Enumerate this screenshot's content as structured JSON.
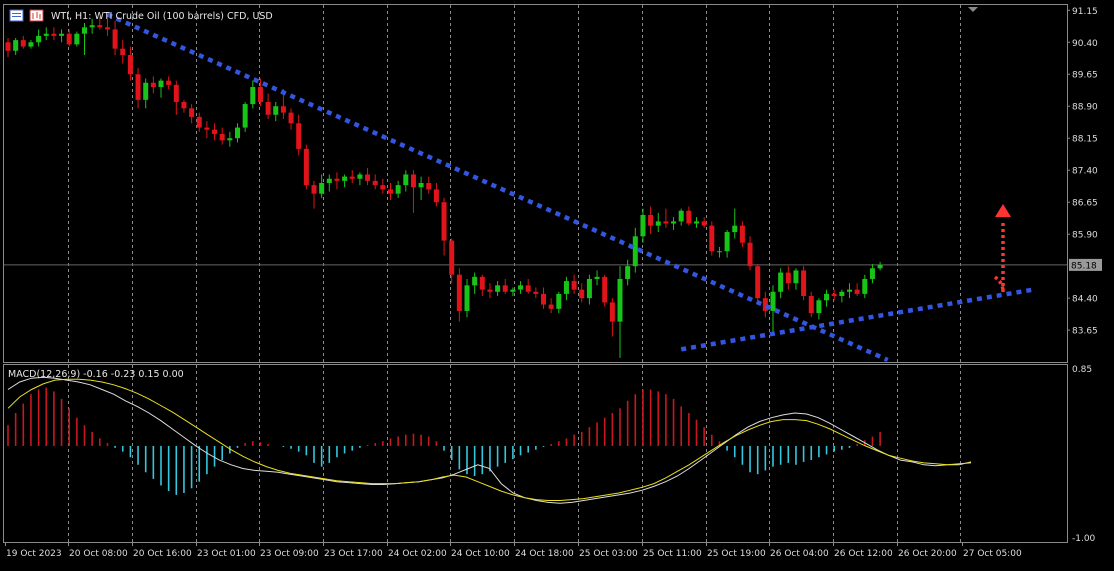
{
  "header": {
    "symbol_title": "WTI, H1:  WTI Crude Oil (100 barrels) CFD, USD",
    "macd_title": "MACD(12,26,9) -0.16 -0.23 0.15 0.00"
  },
  "colors": {
    "background": "#000000",
    "grid": "#8a8a8a",
    "bull": "#19c419",
    "bear": "#e0141a",
    "wick": "#e6e6e6",
    "trendline": "#3355e0",
    "arrow": "#ff3333",
    "macd_pos": "#c8181e",
    "macd_neg": "#36c6dd",
    "signal": "#e8e020",
    "macd_line": "#dddddd"
  },
  "chart_data": [
    {
      "type": "candlestick",
      "name": "price",
      "price_axis_ticks": [
        "91.15",
        "90.40",
        "89.65",
        "88.90",
        "88.15",
        "87.40",
        "86.65",
        "85.90",
        "85.18",
        "84.40",
        "83.65"
      ],
      "current_price": "85.18",
      "ylim": [
        82.95,
        91.25
      ],
      "time_labels": [
        "19 Oct 2023",
        "20 Oct 08:00",
        "20 Oct 16:00",
        "23 Oct 01:00",
        "23 Oct 09:00",
        "23 Oct 17:00",
        "24 Oct 02:00",
        "24 Oct 10:00",
        "24 Oct 18:00",
        "25 Oct 03:00",
        "25 Oct 11:00",
        "25 Oct 19:00",
        "26 Oct 04:00",
        "26 Oct 12:00",
        "26 Oct 20:00",
        "27 Oct 05:00"
      ],
      "candles": [
        [
          90.4,
          90.5,
          90.05,
          90.2
        ],
        [
          90.2,
          90.5,
          90.1,
          90.45
        ],
        [
          90.45,
          90.55,
          90.25,
          90.3
        ],
        [
          90.3,
          90.45,
          90.25,
          90.4
        ],
        [
          90.4,
          90.7,
          90.3,
          90.55
        ],
        [
          90.55,
          90.75,
          90.45,
          90.6
        ],
        [
          90.6,
          90.75,
          90.45,
          90.55
        ],
        [
          90.55,
          90.7,
          90.4,
          90.6
        ],
        [
          90.6,
          90.7,
          90.3,
          90.35
        ],
        [
          90.35,
          90.65,
          90.3,
          90.6
        ],
        [
          90.6,
          90.85,
          90.1,
          90.75
        ],
        [
          90.75,
          90.95,
          90.6,
          90.8
        ],
        [
          90.8,
          91.0,
          90.7,
          90.75
        ],
        [
          90.75,
          90.95,
          90.55,
          90.7
        ],
        [
          90.7,
          90.9,
          90.1,
          90.25
        ],
        [
          90.25,
          90.45,
          89.9,
          90.1
        ],
        [
          90.1,
          90.3,
          89.5,
          89.65
        ],
        [
          89.65,
          89.8,
          88.85,
          89.05
        ],
        [
          89.05,
          89.55,
          88.85,
          89.45
        ],
        [
          89.45,
          89.6,
          89.2,
          89.35
        ],
        [
          89.35,
          89.55,
          89.1,
          89.5
        ],
        [
          89.5,
          89.6,
          89.3,
          89.4
        ],
        [
          89.4,
          89.5,
          88.7,
          89.0
        ],
        [
          89.0,
          89.05,
          88.75,
          88.85
        ],
        [
          88.85,
          88.95,
          88.5,
          88.65
        ],
        [
          88.65,
          88.75,
          88.3,
          88.4
        ],
        [
          88.4,
          88.55,
          88.15,
          88.35
        ],
        [
          88.35,
          88.5,
          88.1,
          88.25
        ],
        [
          88.25,
          88.4,
          88.0,
          88.1
        ],
        [
          88.1,
          88.3,
          87.95,
          88.15
        ],
        [
          88.15,
          88.5,
          88.05,
          88.4
        ],
        [
          88.4,
          89.0,
          88.3,
          88.95
        ],
        [
          88.95,
          89.5,
          88.85,
          89.35
        ],
        [
          89.35,
          89.55,
          88.9,
          89.0
        ],
        [
          89.0,
          89.2,
          88.6,
          88.7
        ],
        [
          88.7,
          89.0,
          88.55,
          88.9
        ],
        [
          88.9,
          89.3,
          88.6,
          88.75
        ],
        [
          88.75,
          88.85,
          88.35,
          88.5
        ],
        [
          88.5,
          88.7,
          87.75,
          87.9
        ],
        [
          87.9,
          88.0,
          86.95,
          87.05
        ],
        [
          87.05,
          87.15,
          86.5,
          86.85
        ],
        [
          86.85,
          87.3,
          86.75,
          87.1
        ],
        [
          87.1,
          87.3,
          86.9,
          87.2
        ],
        [
          87.2,
          87.35,
          86.95,
          87.15
        ],
        [
          87.15,
          87.3,
          87.0,
          87.25
        ],
        [
          87.25,
          87.4,
          87.1,
          87.2
        ],
        [
          87.2,
          87.35,
          87.05,
          87.3
        ],
        [
          87.3,
          87.45,
          87.05,
          87.15
        ],
        [
          87.15,
          87.3,
          86.95,
          87.05
        ],
        [
          87.05,
          87.2,
          86.85,
          86.95
        ],
        [
          86.95,
          87.1,
          86.7,
          86.85
        ],
        [
          86.85,
          87.15,
          86.75,
          87.05
        ],
        [
          87.05,
          87.4,
          86.9,
          87.3
        ],
        [
          87.3,
          87.4,
          86.4,
          87.0
        ],
        [
          87.0,
          87.25,
          86.7,
          87.1
        ],
        [
          87.1,
          87.25,
          86.85,
          86.95
        ],
        [
          86.95,
          87.1,
          86.55,
          86.65
        ],
        [
          86.65,
          86.75,
          85.4,
          85.75
        ],
        [
          85.75,
          85.8,
          84.75,
          84.95
        ],
        [
          84.95,
          85.1,
          83.85,
          84.1
        ],
        [
          84.1,
          84.85,
          83.95,
          84.7
        ],
        [
          84.7,
          85.0,
          84.5,
          84.9
        ],
        [
          84.9,
          84.95,
          84.45,
          84.6
        ],
        [
          84.6,
          84.75,
          84.4,
          84.55
        ],
        [
          84.55,
          84.8,
          84.45,
          84.7
        ],
        [
          84.7,
          84.85,
          84.5,
          84.55
        ],
        [
          84.55,
          84.65,
          84.45,
          84.6
        ],
        [
          84.6,
          84.8,
          84.5,
          84.7
        ],
        [
          84.7,
          84.85,
          84.5,
          84.55
        ],
        [
          84.55,
          84.65,
          84.4,
          84.5
        ],
        [
          84.5,
          84.65,
          84.15,
          84.25
        ],
        [
          84.25,
          84.4,
          84.05,
          84.15
        ],
        [
          84.15,
          84.55,
          84.05,
          84.5
        ],
        [
          84.5,
          84.9,
          84.35,
          84.8
        ],
        [
          84.8,
          84.95,
          84.5,
          84.6
        ],
        [
          84.6,
          84.75,
          84.3,
          84.4
        ],
        [
          84.4,
          84.95,
          84.25,
          84.85
        ],
        [
          84.85,
          85.05,
          84.7,
          84.9
        ],
        [
          84.9,
          84.95,
          84.2,
          84.3
        ],
        [
          84.3,
          84.4,
          83.5,
          83.85
        ],
        [
          83.85,
          85.15,
          83.0,
          84.85
        ],
        [
          84.85,
          85.3,
          84.7,
          85.15
        ],
        [
          85.15,
          86.05,
          85.0,
          85.85
        ],
        [
          85.85,
          86.5,
          85.7,
          86.35
        ],
        [
          86.35,
          86.55,
          85.9,
          86.1
        ],
        [
          86.1,
          86.4,
          85.95,
          86.2
        ],
        [
          86.2,
          86.5,
          86.05,
          86.15
        ],
        [
          86.15,
          86.3,
          86.0,
          86.2
        ],
        [
          86.2,
          86.5,
          86.1,
          86.45
        ],
        [
          86.45,
          86.55,
          86.1,
          86.15
        ],
        [
          86.15,
          86.3,
          86.05,
          86.2
        ],
        [
          86.2,
          86.3,
          86.05,
          86.1
        ],
        [
          86.1,
          86.2,
          85.4,
          85.5
        ],
        [
          85.5,
          85.6,
          85.35,
          85.5
        ],
        [
          85.5,
          86.0,
          85.35,
          85.95
        ],
        [
          85.95,
          86.5,
          85.8,
          86.1
        ],
        [
          86.1,
          86.2,
          85.6,
          85.7
        ],
        [
          85.7,
          85.85,
          85.05,
          85.15
        ],
        [
          85.15,
          85.2,
          84.3,
          84.4
        ],
        [
          84.4,
          84.55,
          83.95,
          84.1
        ],
        [
          84.1,
          84.7,
          83.55,
          84.55
        ],
        [
          84.55,
          85.1,
          84.4,
          85.0
        ],
        [
          85.0,
          85.15,
          84.6,
          84.75
        ],
        [
          84.75,
          85.1,
          84.6,
          85.05
        ],
        [
          85.05,
          85.15,
          84.35,
          84.45
        ],
        [
          84.45,
          84.55,
          83.95,
          84.05
        ],
        [
          84.05,
          84.4,
          83.9,
          84.35
        ],
        [
          84.35,
          84.6,
          84.2,
          84.5
        ],
        [
          84.5,
          84.6,
          84.35,
          84.45
        ],
        [
          84.45,
          84.6,
          84.3,
          84.55
        ],
        [
          84.55,
          84.75,
          84.4,
          84.6
        ],
        [
          84.6,
          84.75,
          84.45,
          84.5
        ],
        [
          84.5,
          84.95,
          84.4,
          84.85
        ],
        [
          84.85,
          85.2,
          84.75,
          85.1
        ],
        [
          85.1,
          85.25,
          85.05,
          85.18
        ]
      ],
      "trendlines": [
        {
          "from": [
            13,
            91.05
          ],
          "to": [
            115,
            82.95
          ]
        },
        {
          "from": [
            88,
            83.2
          ],
          "to": [
            134,
            84.6
          ]
        }
      ]
    },
    {
      "type": "macd",
      "name": "MACD(12,26,9)",
      "axis_ticks": [
        "0.85",
        "-1.00"
      ],
      "ylim": [
        -1.0,
        0.85
      ],
      "histogram": [
        0.22,
        0.35,
        0.45,
        0.55,
        0.6,
        0.62,
        0.58,
        0.5,
        0.4,
        0.3,
        0.22,
        0.15,
        0.08,
        0.03,
        -0.02,
        -0.06,
        -0.12,
        -0.2,
        -0.28,
        -0.35,
        -0.42,
        -0.48,
        -0.52,
        -0.5,
        -0.45,
        -0.38,
        -0.3,
        -0.22,
        -0.15,
        -0.08,
        -0.02,
        0.03,
        0.05,
        0.04,
        0.02,
        0.0,
        -0.01,
        -0.03,
        -0.06,
        -0.1,
        -0.18,
        -0.22,
        -0.18,
        -0.12,
        -0.08,
        -0.05,
        -0.02,
        0.01,
        0.03,
        0.05,
        0.08,
        0.1,
        0.12,
        0.13,
        0.12,
        0.1,
        0.05,
        -0.05,
        -0.15,
        -0.25,
        -0.3,
        -0.32,
        -0.3,
        -0.27,
        -0.22,
        -0.18,
        -0.14,
        -0.1,
        -0.07,
        -0.04,
        -0.01,
        0.02,
        0.05,
        0.08,
        0.12,
        0.15,
        0.2,
        0.25,
        0.3,
        0.35,
        0.4,
        0.48,
        0.55,
        0.6,
        0.6,
        0.58,
        0.55,
        0.5,
        0.42,
        0.35,
        0.28,
        0.2,
        0.12,
        0.05,
        -0.05,
        -0.12,
        -0.2,
        -0.28,
        -0.3,
        -0.26,
        -0.22,
        -0.2,
        -0.18,
        -0.2,
        -0.17,
        -0.15,
        -0.12,
        -0.09,
        -0.06,
        -0.04,
        -0.02,
        0.02,
        0.06,
        0.1,
        0.15
      ],
      "macd_line": [
        0.6,
        0.68,
        0.72,
        0.73,
        0.72,
        0.7,
        0.68,
        0.65,
        0.6,
        0.55,
        0.48,
        0.42,
        0.35,
        0.27,
        0.18,
        0.09,
        0.0,
        -0.08,
        -0.15,
        -0.2,
        -0.24,
        -0.26,
        -0.27,
        -0.28,
        -0.3,
        -0.32,
        -0.34,
        -0.36,
        -0.38,
        -0.39,
        -0.4,
        -0.41,
        -0.41,
        -0.4,
        -0.39,
        -0.38,
        -0.36,
        -0.34,
        -0.3,
        -0.25,
        -0.2,
        -0.24,
        -0.4,
        -0.5,
        -0.55,
        -0.58,
        -0.6,
        -0.61,
        -0.6,
        -0.58,
        -0.56,
        -0.54,
        -0.52,
        -0.5,
        -0.47,
        -0.43,
        -0.38,
        -0.32,
        -0.24,
        -0.15,
        -0.06,
        0.03,
        0.12,
        0.2,
        0.26,
        0.3,
        0.33,
        0.35,
        0.34,
        0.3,
        0.24,
        0.17,
        0.1,
        0.03,
        -0.04,
        -0.1,
        -0.15,
        -0.17,
        -0.2,
        -0.21,
        -0.2,
        -0.2,
        -0.17
      ],
      "signal_line": [
        0.4,
        0.52,
        0.6,
        0.66,
        0.7,
        0.71,
        0.71,
        0.7,
        0.68,
        0.65,
        0.61,
        0.56,
        0.5,
        0.43,
        0.36,
        0.28,
        0.2,
        0.12,
        0.04,
        -0.04,
        -0.11,
        -0.17,
        -0.22,
        -0.26,
        -0.29,
        -0.31,
        -0.33,
        -0.35,
        -0.37,
        -0.38,
        -0.39,
        -0.4,
        -0.4,
        -0.4,
        -0.39,
        -0.38,
        -0.36,
        -0.33,
        -0.31,
        -0.33,
        -0.38,
        -0.43,
        -0.48,
        -0.52,
        -0.55,
        -0.57,
        -0.58,
        -0.58,
        -0.57,
        -0.56,
        -0.54,
        -0.52,
        -0.5,
        -0.47,
        -0.44,
        -0.4,
        -0.34,
        -0.27,
        -0.2,
        -0.12,
        -0.04,
        0.04,
        0.11,
        0.17,
        0.22,
        0.26,
        0.28,
        0.28,
        0.27,
        0.23,
        0.18,
        0.12,
        0.06,
        0.0,
        -0.05,
        -0.1,
        -0.13,
        -0.16,
        -0.18,
        -0.19,
        -0.2,
        -0.19,
        -0.18
      ]
    }
  ]
}
